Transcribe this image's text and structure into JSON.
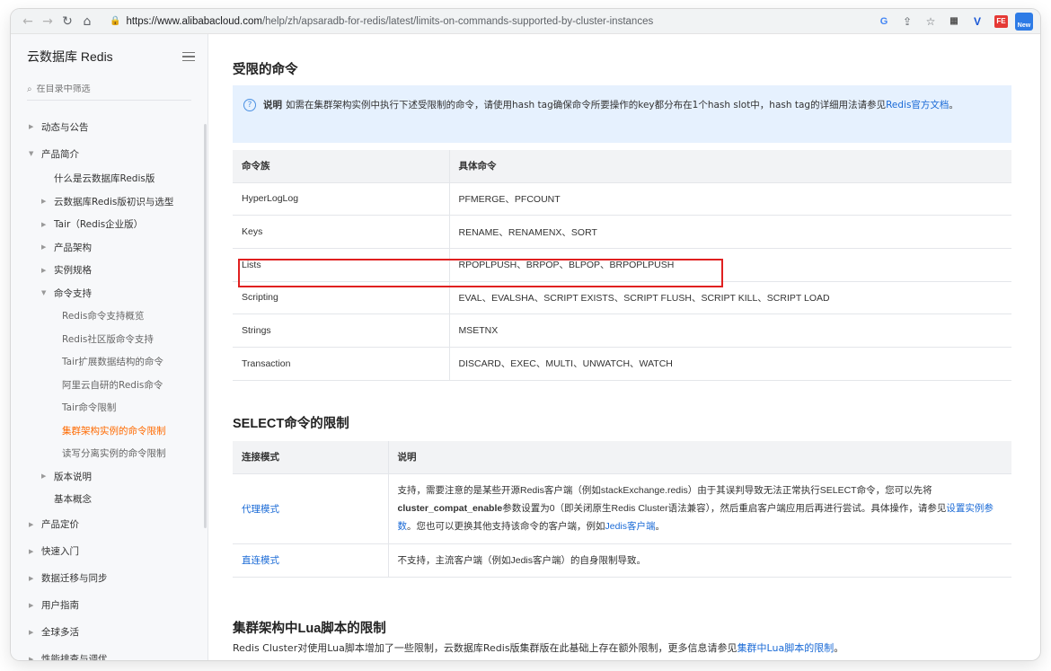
{
  "browser": {
    "url_base": "https://www.alibabacloud.com",
    "url_path": "/help/zh/apsaradb-for-redis/latest/limits-on-commands-supported-by-cluster-instances",
    "ext_g": "G",
    "ext_v": "V",
    "ext_fe": "FE",
    "ext_news": "New"
  },
  "sidebar": {
    "title": "云数据库 Redis",
    "search_placeholder": "在目录中筛选",
    "items": [
      {
        "label": "动态与公告",
        "level": 0,
        "chev": "right"
      },
      {
        "label": "产品简介",
        "level": 0,
        "chev": "down"
      },
      {
        "label": "什么是云数据库Redis版",
        "level": 1,
        "chev": "none"
      },
      {
        "label": "云数据库Redis版初识与选型",
        "level": 1,
        "chev": "right"
      },
      {
        "label": "Tair（Redis企业版）",
        "level": 1,
        "chev": "right"
      },
      {
        "label": "产品架构",
        "level": 1,
        "chev": "right"
      },
      {
        "label": "实例规格",
        "level": 1,
        "chev": "right"
      },
      {
        "label": "命令支持",
        "level": 1,
        "chev": "down"
      },
      {
        "label": "Redis命令支持概览",
        "level": 2
      },
      {
        "label": "Redis社区版命令支持",
        "level": 2
      },
      {
        "label": "Tair扩展数据结构的命令",
        "level": 2
      },
      {
        "label": "阿里云自研的Redis命令",
        "level": 2
      },
      {
        "label": "Tair命令限制",
        "level": 2
      },
      {
        "label": "集群架构实例的命令限制",
        "level": 2,
        "active": true
      },
      {
        "label": "读写分离实例的命令限制",
        "level": 2
      },
      {
        "label": "版本说明",
        "level": 1,
        "chev": "right"
      },
      {
        "label": "基本概念",
        "level": 1,
        "chev": "none"
      },
      {
        "label": "产品定价",
        "level": 0,
        "chev": "right"
      },
      {
        "label": "快速入门",
        "level": 0,
        "chev": "right"
      },
      {
        "label": "数据迁移与同步",
        "level": 0,
        "chev": "right"
      },
      {
        "label": "用户指南",
        "level": 0,
        "chev": "right"
      },
      {
        "label": "全球多活",
        "level": 0,
        "chev": "right"
      },
      {
        "label": "性能排查与调优",
        "level": 0,
        "chev": "right"
      }
    ]
  },
  "main": {
    "restricted_title": "受限的命令",
    "note": {
      "label": "说明",
      "text": "如需在集群架构实例中执行下述受限制的命令，请使用hash tag确保命令所要操作的key都分布在1个hash slot中，hash tag的详细用法请参见",
      "link": "Redis官方文档",
      "end": "。"
    },
    "table1": {
      "headers": [
        "命令族",
        "具体命令"
      ],
      "rows": [
        [
          "HyperLogLog",
          "PFMERGE、PFCOUNT"
        ],
        [
          "Keys",
          "RENAME、RENAMENX、SORT"
        ],
        [
          "Lists",
          "RPOPLPUSH、BRPOP、BLPOP、BRPOPLPUSH"
        ],
        [
          "Scripting",
          "EVAL、EVALSHA、SCRIPT EXISTS、SCRIPT FLUSH、SCRIPT KILL、SCRIPT LOAD"
        ],
        [
          "Strings",
          "MSETNX"
        ],
        [
          "Transaction",
          "DISCARD、EXEC、MULTI、UNWATCH、WATCH"
        ]
      ]
    },
    "select_title": "SELECT命令的限制",
    "table2": {
      "headers": [
        "连接模式",
        "说明"
      ],
      "proxy_mode": "代理模式",
      "proxy_desc_1": "支持，需要注意的是某些开源Redis客户端（例如stackExchange.redis）由于其误判导致无法正常执行SELECT命令，您可以先将",
      "proxy_param": "cluster_compat_enable",
      "proxy_desc_2": "参数设置为0（即关闭原生Redis Cluster语法兼容），然后重启客户端应用后再进行尝试。具体操作，请参见",
      "proxy_link_1": "设置实例参数",
      "proxy_desc_3": "。您也可以更换其他支持该命令的客户端，例如",
      "proxy_link_2": "Jedis客户端",
      "proxy_desc_4": "。",
      "direct_mode": "直连模式",
      "direct_desc": "不支持，主流客户端（例如Jedis客户端）的自身限制导致。"
    },
    "lua_title": "集群架构中Lua脚本的限制",
    "lua_text": "Redis Cluster对使用Lua脚本增加了一些限制，云数据库Redis版集群版在此基础上存在额外限制，更多信息请参见",
    "lua_link": "集群中Lua脚本的限制",
    "lua_end": "。"
  }
}
